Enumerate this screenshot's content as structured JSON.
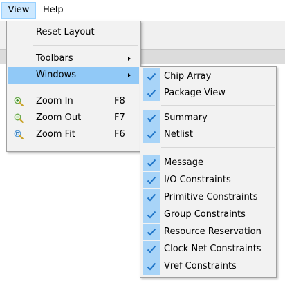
{
  "menubar": {
    "items": [
      {
        "label": "View"
      },
      {
        "label": "Help"
      }
    ]
  },
  "view_menu": {
    "items": [
      {
        "label": "Reset Layout"
      },
      {
        "label": "Toolbars"
      },
      {
        "label": "Windows"
      },
      {
        "label": "Zoom In",
        "shortcut": "F8",
        "icon": "zoom-in-icon"
      },
      {
        "label": "Zoom Out",
        "shortcut": "F7",
        "icon": "zoom-out-icon"
      },
      {
        "label": "Zoom Fit",
        "shortcut": "F6",
        "icon": "zoom-fit-icon"
      }
    ]
  },
  "windows_submenu": {
    "items": [
      {
        "label": "Chip Array",
        "checked": true
      },
      {
        "label": "Package View",
        "checked": true
      },
      {
        "label": "Summary",
        "checked": true
      },
      {
        "label": "Netlist",
        "checked": true
      },
      {
        "label": "Message",
        "checked": true
      },
      {
        "label": "I/O Constraints",
        "checked": true
      },
      {
        "label": "Primitive Constraints",
        "checked": true
      },
      {
        "label": "Group Constraints",
        "checked": true
      },
      {
        "label": "Resource Reservation",
        "checked": true
      },
      {
        "label": "Clock Net Constraints",
        "checked": true
      },
      {
        "label": "Vref Constraints",
        "checked": true
      }
    ]
  },
  "colors": {
    "highlight": "#91c9f7",
    "check_column": "#a8d4f8",
    "check_mark": "#1e74c8",
    "menubar_active": "#cce8ff"
  }
}
